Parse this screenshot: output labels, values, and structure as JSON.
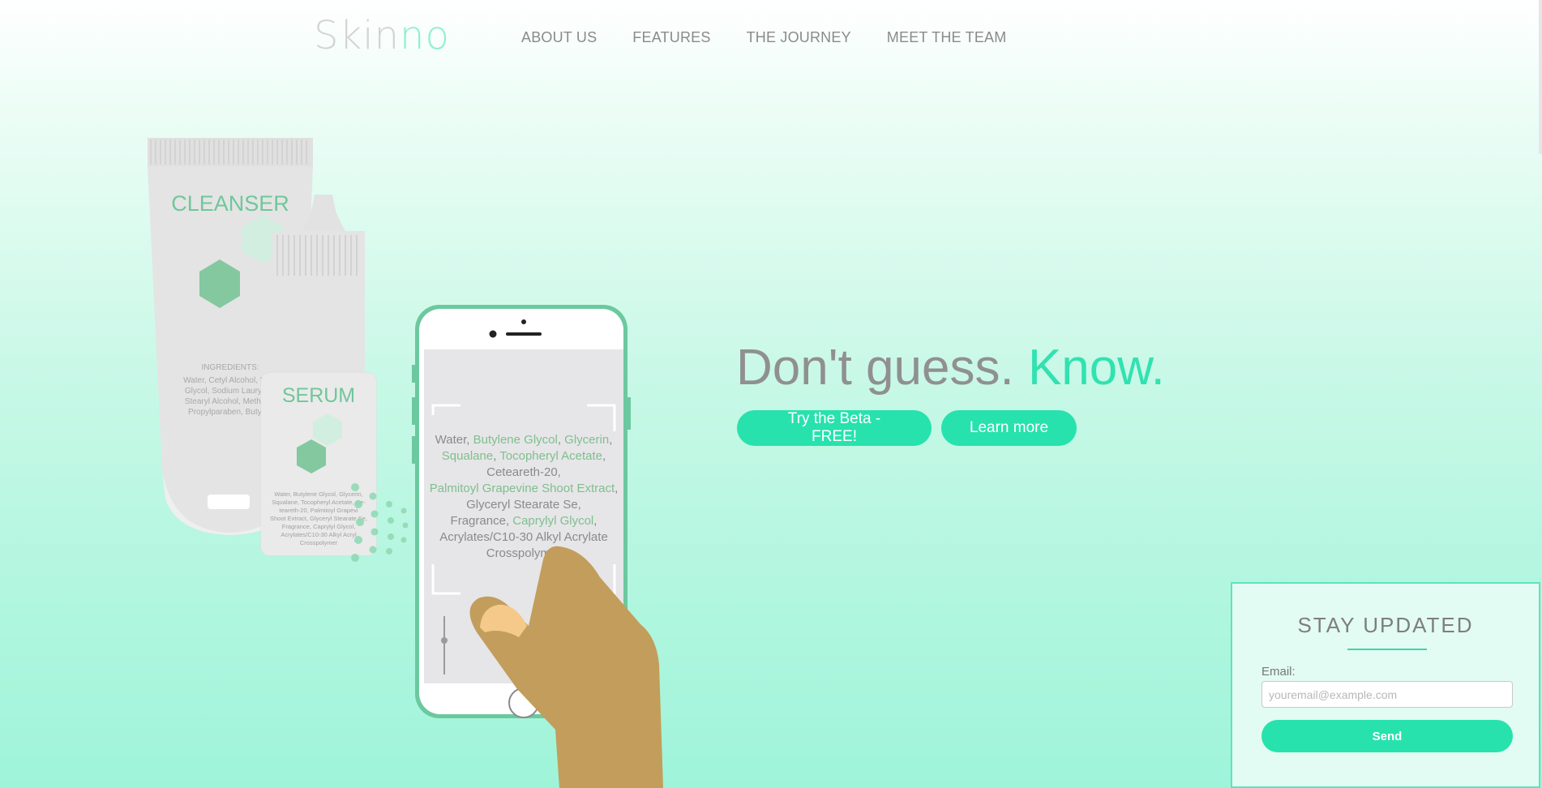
{
  "brand": {
    "logo_part1": "Skin",
    "logo_part2": "no"
  },
  "nav": {
    "items": [
      "ABOUT US",
      "FEATURES",
      "THE JOURNEY",
      "MEET THE TEAM"
    ]
  },
  "hero": {
    "title_part1": "Don't guess.",
    "title_part2": "Know.",
    "cta_beta": "Try the Beta - FREE!",
    "cta_learn": "Learn more"
  },
  "illustration": {
    "cleanser_label": "CLEANSER",
    "cleanser_ingredients_heading": "INGREDIENTS:",
    "cleanser_ingredients_lines": [
      "Water, Cetyl Alcohol, Prop",
      "Glycol, Sodium Lauryl Su",
      "Stearyl Alcohol, Methylpa",
      "Propylparaben, Butylpa"
    ],
    "serum_label": "SERUM",
    "serum_ingredients_lines": [
      "Water, Butylene Glycol, Glycerin,",
      "Squalane, Tocopheryl Acetate, Ce-",
      "teareth-20, Palmitoyl Grapevi",
      "Shoot Extract, Glyceryl Stearate Se,",
      "Fragrance, Caprylyl Glycol,",
      "Acrylates/C10-30 Alkyl Acryl",
      "Crosspolymer"
    ],
    "phone_ingredients_lines": [
      [
        "Water, ",
        "Butylene Glycol",
        ", ",
        "Glycerin",
        ","
      ],
      [
        "Squalane",
        ", ",
        "Tocopheryl Acetate",
        ","
      ],
      [
        "Ceteareth-20,"
      ],
      [
        "Palmitoyl Grapevine Shoot Extract",
        ","
      ],
      [
        "Glyceryl Stearate Se,"
      ],
      [
        "Fragrance, ",
        "Caprylyl Glycol",
        ","
      ],
      [
        "Acrylates/C10-30 Alkyl Acrylate"
      ],
      [
        "Crosspolymer"
      ]
    ]
  },
  "newsletter": {
    "title": "STAY UPDATED",
    "email_label": "Email:",
    "email_placeholder": "youremail@example.com",
    "send_label": "Send"
  },
  "colors": {
    "accent": "#27e2ad",
    "highlight": "#8ed6a8",
    "hand": "#c39d5b"
  }
}
